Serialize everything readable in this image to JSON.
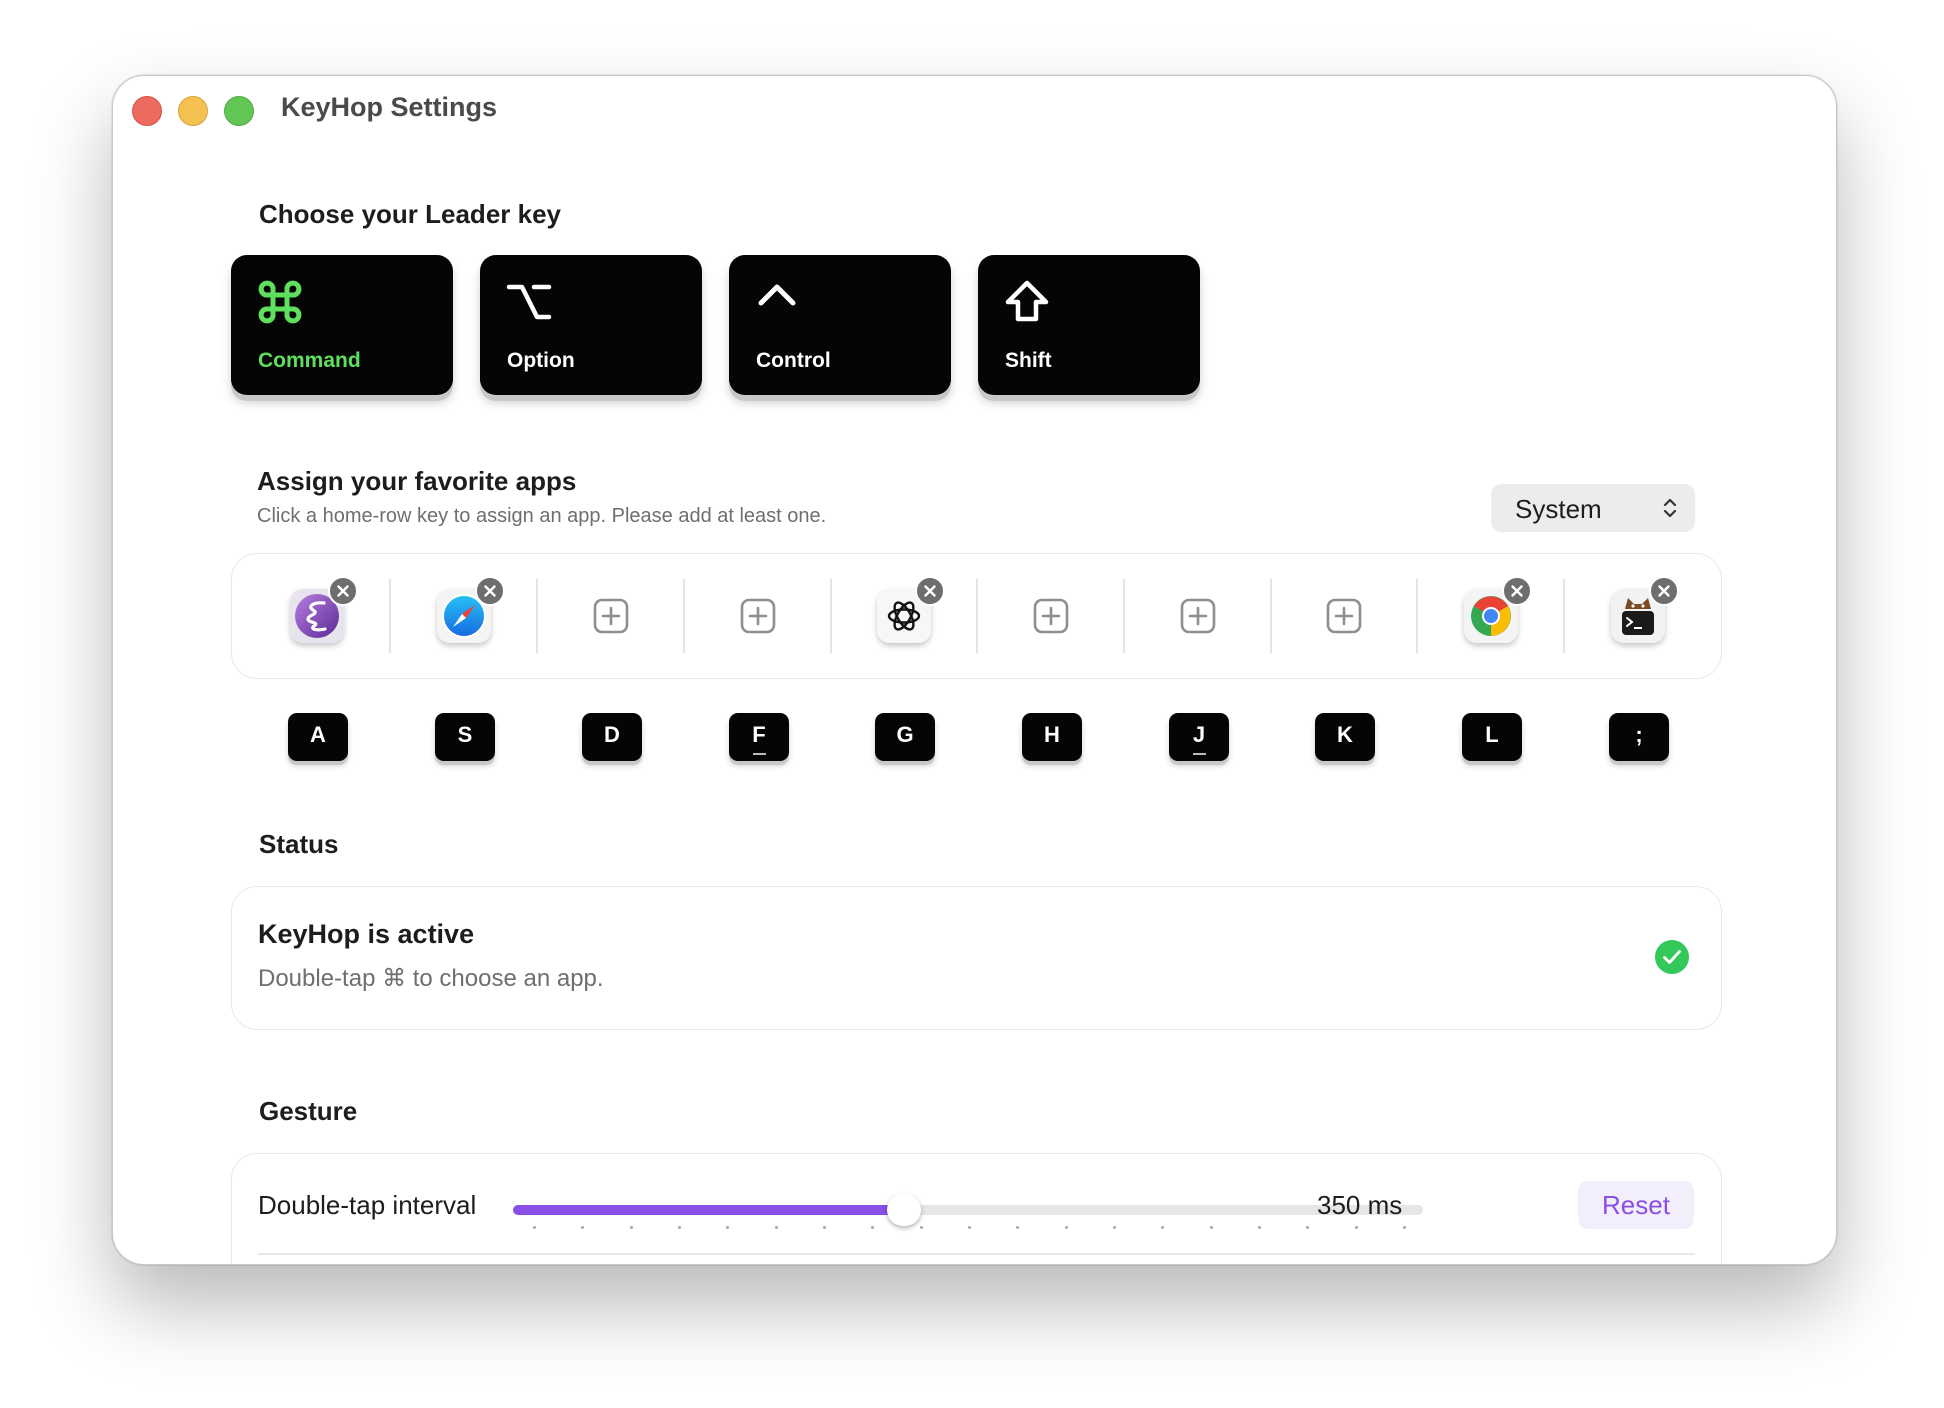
{
  "window": {
    "title": "KeyHop Settings",
    "controls": [
      "close",
      "minimize",
      "zoom"
    ]
  },
  "leader": {
    "heading": "Choose your Leader key",
    "selected": "Command",
    "keys": [
      {
        "label": "Command",
        "icon": "command-icon",
        "selected": true
      },
      {
        "label": "Option",
        "icon": "option-icon",
        "selected": false
      },
      {
        "label": "Control",
        "icon": "control-caret-icon",
        "selected": false
      },
      {
        "label": "Shift",
        "icon": "shift-arrow-icon",
        "selected": false
      }
    ]
  },
  "apps": {
    "heading": "Assign your favorite apps",
    "subtitle": "Click a home-row key to assign an app. Please add at least one.",
    "dropdown_value": "System",
    "slots": [
      {
        "key": "A",
        "app": "emacs-icon",
        "assigned": true
      },
      {
        "key": "S",
        "app": "safari-icon",
        "assigned": true
      },
      {
        "key": "D",
        "app": "add-icon",
        "assigned": false
      },
      {
        "key": "F",
        "app": "add-icon",
        "assigned": false
      },
      {
        "key": "G",
        "app": "chatgpt-icon",
        "assigned": true
      },
      {
        "key": "H",
        "app": "add-icon",
        "assigned": false
      },
      {
        "key": "J",
        "app": "add-icon",
        "assigned": false
      },
      {
        "key": "K",
        "app": "add-icon",
        "assigned": false
      },
      {
        "key": "L",
        "app": "chrome-icon",
        "assigned": true
      },
      {
        "key": ";",
        "app": "terminal-cat-icon",
        "assigned": true
      }
    ]
  },
  "status": {
    "heading": "Status",
    "title": "KeyHop is active",
    "description": "Double-tap ⌘ to choose an app.",
    "state_color": "#34c759"
  },
  "gesture": {
    "heading": "Gesture",
    "slider_label": "Double-tap interval",
    "slider_fraction": 0.43,
    "value_label": "350 ms",
    "reset_label": "Reset",
    "accent_color": "#8a4fe6"
  }
}
